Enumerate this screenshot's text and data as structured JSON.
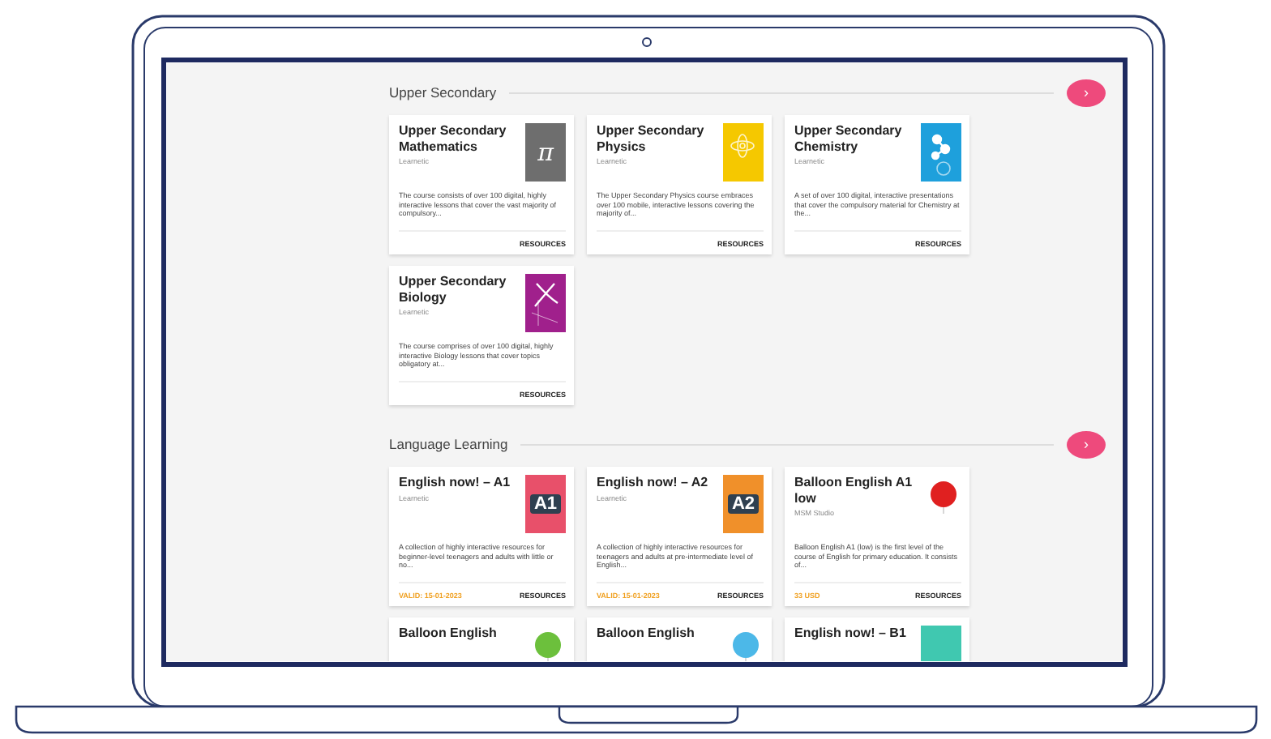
{
  "sections": [
    {
      "title": "Upper Secondary",
      "next_button": "›",
      "courses": [
        {
          "title": "Upper Secondary Mathematics",
          "publisher": "Learnetic",
          "description": "The course consists of over 100 digital, highly interactive lessons that cover the vast majority of compulsory...",
          "action": "RESOURCES",
          "cover": {
            "kind": "symbol",
            "color": "#6e6e6e",
            "text": "π"
          }
        },
        {
          "title": "Upper Secondary Physics",
          "publisher": "Learnetic",
          "description": "The Upper Secondary Physics course embraces over 100 mobile, interactive lessons covering the majority of...",
          "action": "RESOURCES",
          "cover": {
            "kind": "atom",
            "color": "#f5c800"
          }
        },
        {
          "title": "Upper Secondary Chemistry",
          "publisher": "Learnetic",
          "description": "A set of over 100 digital, interactive presentations that cover the compulsory material for Chemistry at the...",
          "action": "RESOURCES",
          "cover": {
            "kind": "molecule",
            "color": "#1ea0dc"
          }
        },
        {
          "title": "Upper Secondary Biology",
          "publisher": "Learnetic",
          "description": "The course comprises of over 100 digital, highly interactive Biology lessons that cover topics obligatory at...",
          "action": "RESOURCES",
          "cover": {
            "kind": "dna",
            "color": "#a0208c"
          }
        }
      ]
    },
    {
      "title": "Language Learning",
      "next_button": "›",
      "courses": [
        {
          "title": "English now! – A1",
          "publisher": "Learnetic",
          "description": "A collection of highly interactive resources for beginner-level teenagers and adults with little or no...",
          "note": "VALID: 15-01-2023",
          "action": "RESOURCES",
          "cover": {
            "kind": "level",
            "color": "#e8506a",
            "text": "A1"
          }
        },
        {
          "title": "English now! – A2",
          "publisher": "Learnetic",
          "description": "A collection of highly interactive resources for teenagers and adults at pre-intermediate level of English...",
          "note": "VALID: 15-01-2023",
          "action": "RESOURCES",
          "cover": {
            "kind": "level",
            "color": "#f0902a",
            "text": "A2"
          }
        },
        {
          "title": "Balloon English A1 low",
          "publisher": "MSM Studio",
          "description": "Balloon English A1 (low) is the first level of the course of English for primary education. It consists of...",
          "note": "33 USD",
          "action": "RESOURCES",
          "cover": {
            "kind": "balloon",
            "color": "#e02020"
          }
        },
        {
          "title": "Balloon English",
          "cover": {
            "kind": "balloon",
            "color": "#6cc03c"
          }
        },
        {
          "title": "Balloon English",
          "cover": {
            "kind": "balloon",
            "color": "#4cb8e8"
          }
        },
        {
          "title": "English now! – B1",
          "cover": {
            "kind": "level",
            "color": "#40c8b0"
          }
        }
      ]
    }
  ]
}
